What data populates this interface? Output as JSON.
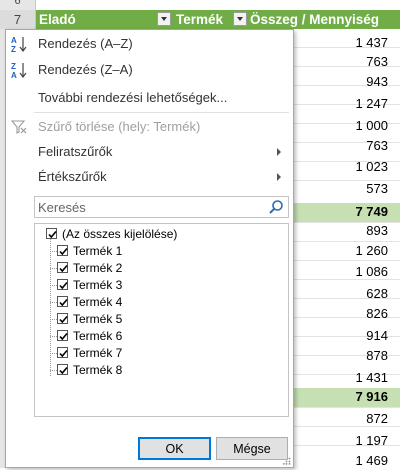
{
  "row_headers": {
    "top": "6",
    "header": "7"
  },
  "headers": {
    "seller": "Eladó",
    "product": "Termék",
    "total": "Összeg / Mennyiség"
  },
  "values": [
    "1 437",
    "763",
    "943",
    "1 247",
    "1 000",
    "763",
    "1 023",
    "573",
    "7 749",
    "893",
    "1 260",
    "1 086",
    "628",
    "826",
    "914",
    "878",
    "1 431",
    "7 916",
    "872",
    "1 197",
    "1 469"
  ],
  "subtotals": [
    "7 749",
    "7 916"
  ],
  "menu": {
    "sort_az": "Rendezés (A–Z)",
    "sort_za": "Rendezés (Z–A)",
    "more_sort": "További rendezési lehetőségek...",
    "clear_filter": "Szűrő törlése (hely: Termék)",
    "label_filters": "Feliratszűrők",
    "value_filters": "Értékszűrők"
  },
  "search": {
    "placeholder": "Keresés"
  },
  "list": {
    "select_all": "(Az összes kijelölése)",
    "items": [
      "Termék 1",
      "Termék 2",
      "Termék 3",
      "Termék 4",
      "Termék 5",
      "Termék 6",
      "Termék 7",
      "Termék 8"
    ]
  },
  "buttons": {
    "ok": "OK",
    "cancel": "Mégse"
  },
  "colors": {
    "header_green": "#70ad47",
    "subtotal_green": "#c6e0b4",
    "accent_blue": "#0078d7"
  }
}
